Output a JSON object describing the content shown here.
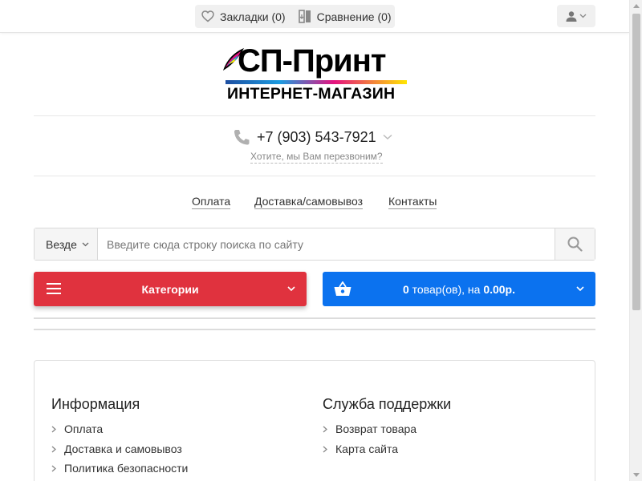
{
  "topbar": {
    "bookmarks": {
      "label": "Закладки (0)",
      "icon": "heart-icon"
    },
    "compare": {
      "label": "Сравнение (0)",
      "icon": "compare-icon"
    },
    "account": {
      "icon": "user-icon"
    }
  },
  "logo": {
    "main": "СП-Принт",
    "sub": "ИНТЕРНЕТ-МАГАЗИН"
  },
  "contact": {
    "phone": "+7 (903) 543-7921",
    "callback": "Хотите, мы Вам перезвоним?"
  },
  "nav": {
    "items": [
      "Оплата",
      "Доставка/самовывоз",
      "Контакты"
    ]
  },
  "search": {
    "scope": "Везде",
    "placeholder": "Введите сюда строку поиска по сайту",
    "value": ""
  },
  "categories": {
    "label": "Категории"
  },
  "cart": {
    "count": "0",
    "middle": " товар(ов), на ",
    "total": "0.00р."
  },
  "footer": {
    "info": {
      "title": "Информация",
      "items": [
        "Оплата",
        "Доставка и самовывоз",
        "Политика безопасности"
      ]
    },
    "support": {
      "title": "Служба поддержки",
      "items": [
        "Возврат товара",
        "Карта сайта"
      ]
    }
  },
  "colors": {
    "categories_bg": "#e0323e",
    "cart_bg": "#0b72ef"
  }
}
